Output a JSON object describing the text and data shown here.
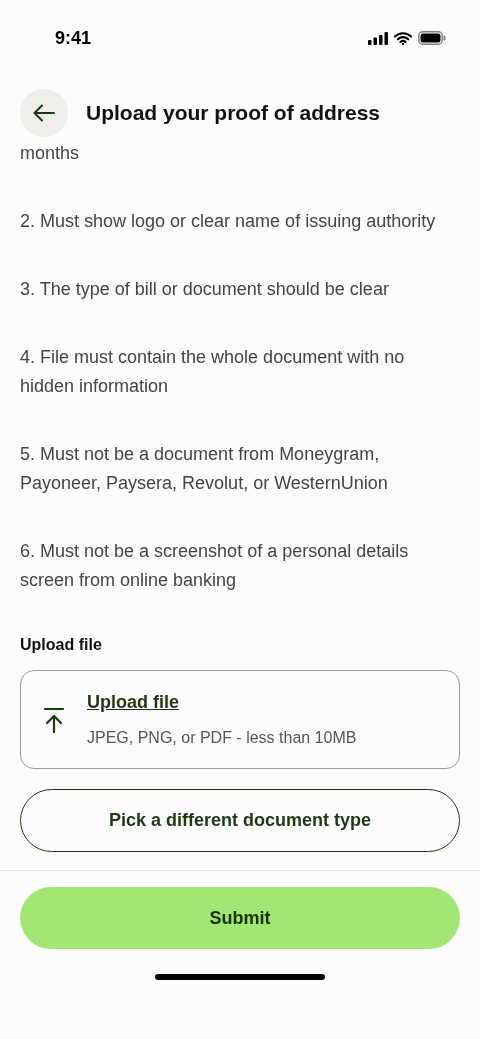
{
  "status_bar": {
    "time": "9:41"
  },
  "header": {
    "title": "Upload your proof of address"
  },
  "requirements": [
    "months",
    "2. Must show logo or clear name of issuing authority",
    "3. The type of bill or document should be clear",
    "4. File must contain the whole document with no hidden information",
    "5. Must not be a document from Moneygram, Payoneer, Paysera, Revolut, or WesternUnion",
    "6. Must not be a screenshot of a personal details screen from online banking"
  ],
  "upload": {
    "label": "Upload file",
    "link": "Upload file",
    "hint": "JPEG, PNG, or PDF - less than 10MB"
  },
  "secondary_button": "Pick a different document type",
  "submit_button": "Submit"
}
